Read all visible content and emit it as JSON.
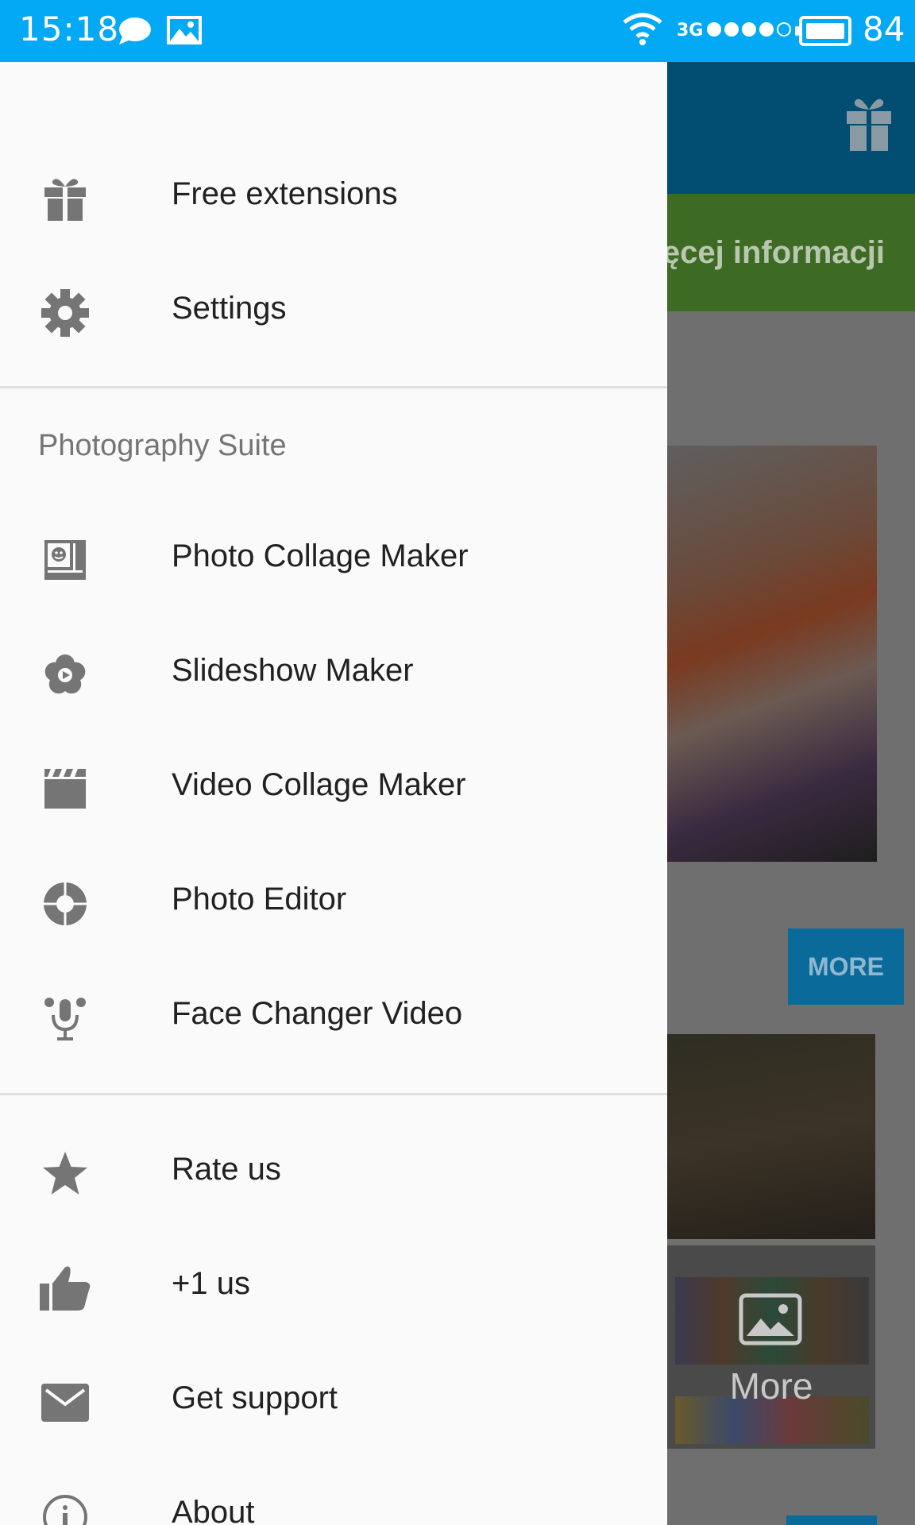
{
  "status_bar": {
    "time": "15:18",
    "network_type": "3G",
    "battery_percent": "84",
    "signal_bars_total": 5,
    "signal_bars_filled": 4,
    "color": "#03a9f4"
  },
  "background_app": {
    "banner_text": "ęcej informacji",
    "more_button_label": "MORE",
    "more_tile_label": "More"
  },
  "drawer": {
    "top_items": [
      {
        "icon": "gift-icon",
        "label": "Free extensions"
      },
      {
        "icon": "gear-icon",
        "label": "Settings"
      }
    ],
    "section_header": "Photography Suite",
    "suite_items": [
      {
        "icon": "photo-collage-icon",
        "label": "Photo Collage Maker"
      },
      {
        "icon": "slideshow-icon",
        "label": "Slideshow Maker"
      },
      {
        "icon": "clapperboard-icon",
        "label": "Video Collage Maker"
      },
      {
        "icon": "lens-aperture-icon",
        "label": "Photo Editor"
      },
      {
        "icon": "microphone-icon",
        "label": "Face Changer Video"
      }
    ],
    "bottom_items": [
      {
        "icon": "star-icon",
        "label": "Rate us"
      },
      {
        "icon": "thumbs-up-icon",
        "label": "+1 us"
      },
      {
        "icon": "mail-icon",
        "label": "Get support"
      },
      {
        "icon": "info-icon",
        "label": "About"
      }
    ],
    "icon_color": "#757575",
    "text_color": "#212121"
  }
}
